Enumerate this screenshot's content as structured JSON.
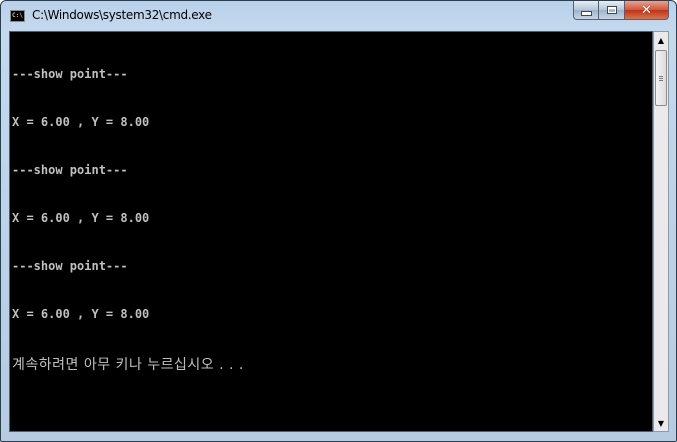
{
  "window": {
    "title": "C:\\Windows\\system32\\cmd.exe",
    "icon_text": "C:\\",
    "buttons": {
      "minimize": "minimize-icon",
      "maximize": "maximize-icon",
      "close": "✕"
    }
  },
  "console": {
    "lines": [
      "---show point---",
      "X = 6.00 , Y = 8.00",
      "---show point---",
      "X = 6.00 , Y = 8.00",
      "---show point---",
      "X = 6.00 , Y = 8.00"
    ],
    "prompt": "계속하려면 아무 키나 누르십시오 . . ."
  },
  "scrollbar": {
    "up": "▲",
    "down": "▼"
  },
  "colors": {
    "console_bg": "#000000",
    "console_fg": "#c0c0c0",
    "title_bg": "#b9d1ea",
    "close_btn": "#c94a2c"
  }
}
